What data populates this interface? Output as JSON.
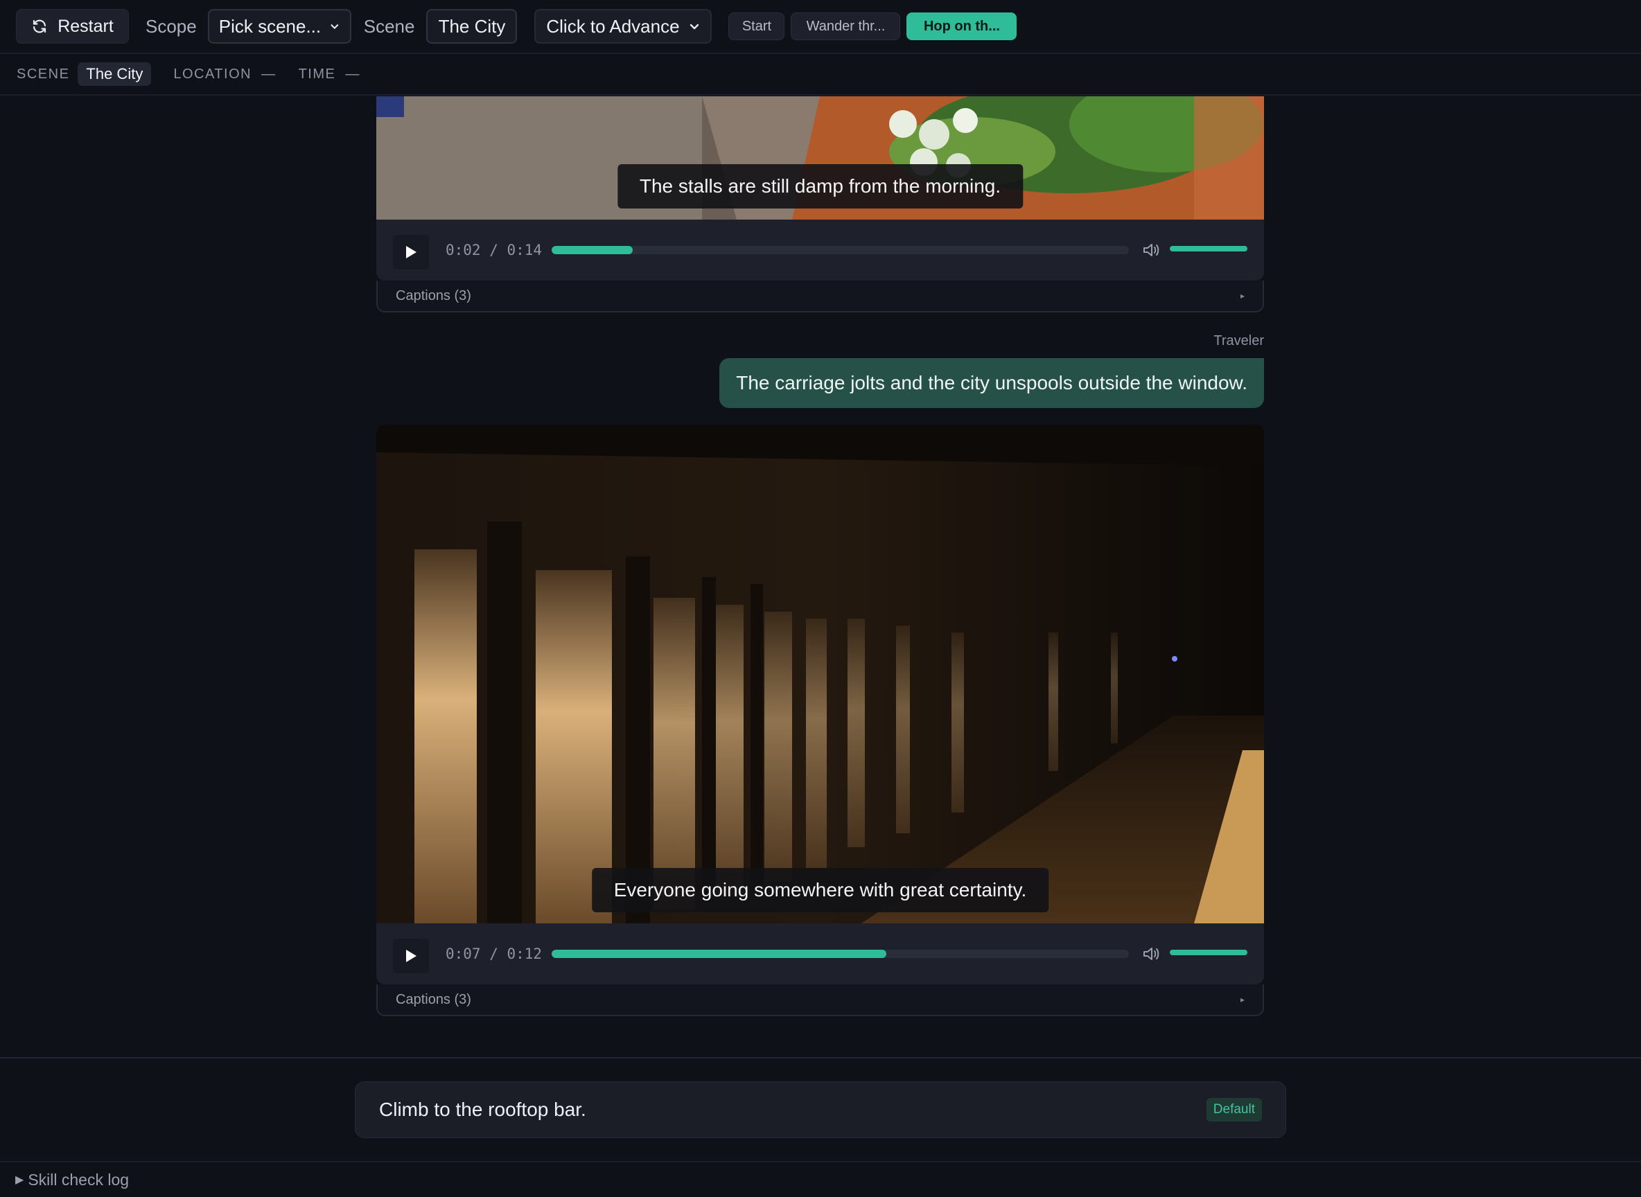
{
  "toolbar": {
    "restart_label": "Restart",
    "scope_label": "Scope",
    "scope_select": "Pick scene...",
    "scene_label": "Scene",
    "scene_value": "The City",
    "advance_mode": "Click to Advance",
    "chips": [
      "Start",
      "Wander thr...",
      "Hop on th..."
    ],
    "active_chip": "Hop on th..."
  },
  "status": {
    "scene_key": "SCENE",
    "scene_value": "The City",
    "location_key": "LOCATION",
    "location_value": "—",
    "time_key": "TIME",
    "time_value": "—"
  },
  "feed": {
    "video1": {
      "subtitle": "The stalls are still damp from the morning.",
      "time": "0:02 / 0:14",
      "progress": 0.14,
      "volume": 1.0,
      "captions": "Captions (3)"
    },
    "message": {
      "speaker": "Traveler",
      "text": "The carriage jolts and the city unspools outside the window."
    },
    "video2": {
      "subtitle": "Everyone going somewhere with great certainty.",
      "time": "0:07 / 0:12",
      "progress": 0.58,
      "volume": 1.0,
      "captions": "Captions (3)"
    }
  },
  "input": {
    "choice_text": "Climb to the rooftop bar.",
    "badge": "Default"
  },
  "footer": {
    "skill_log": "Skill check log"
  },
  "colors": {
    "accent": "#2ebd98",
    "background": "#0f1118",
    "bubble": "#265149"
  }
}
